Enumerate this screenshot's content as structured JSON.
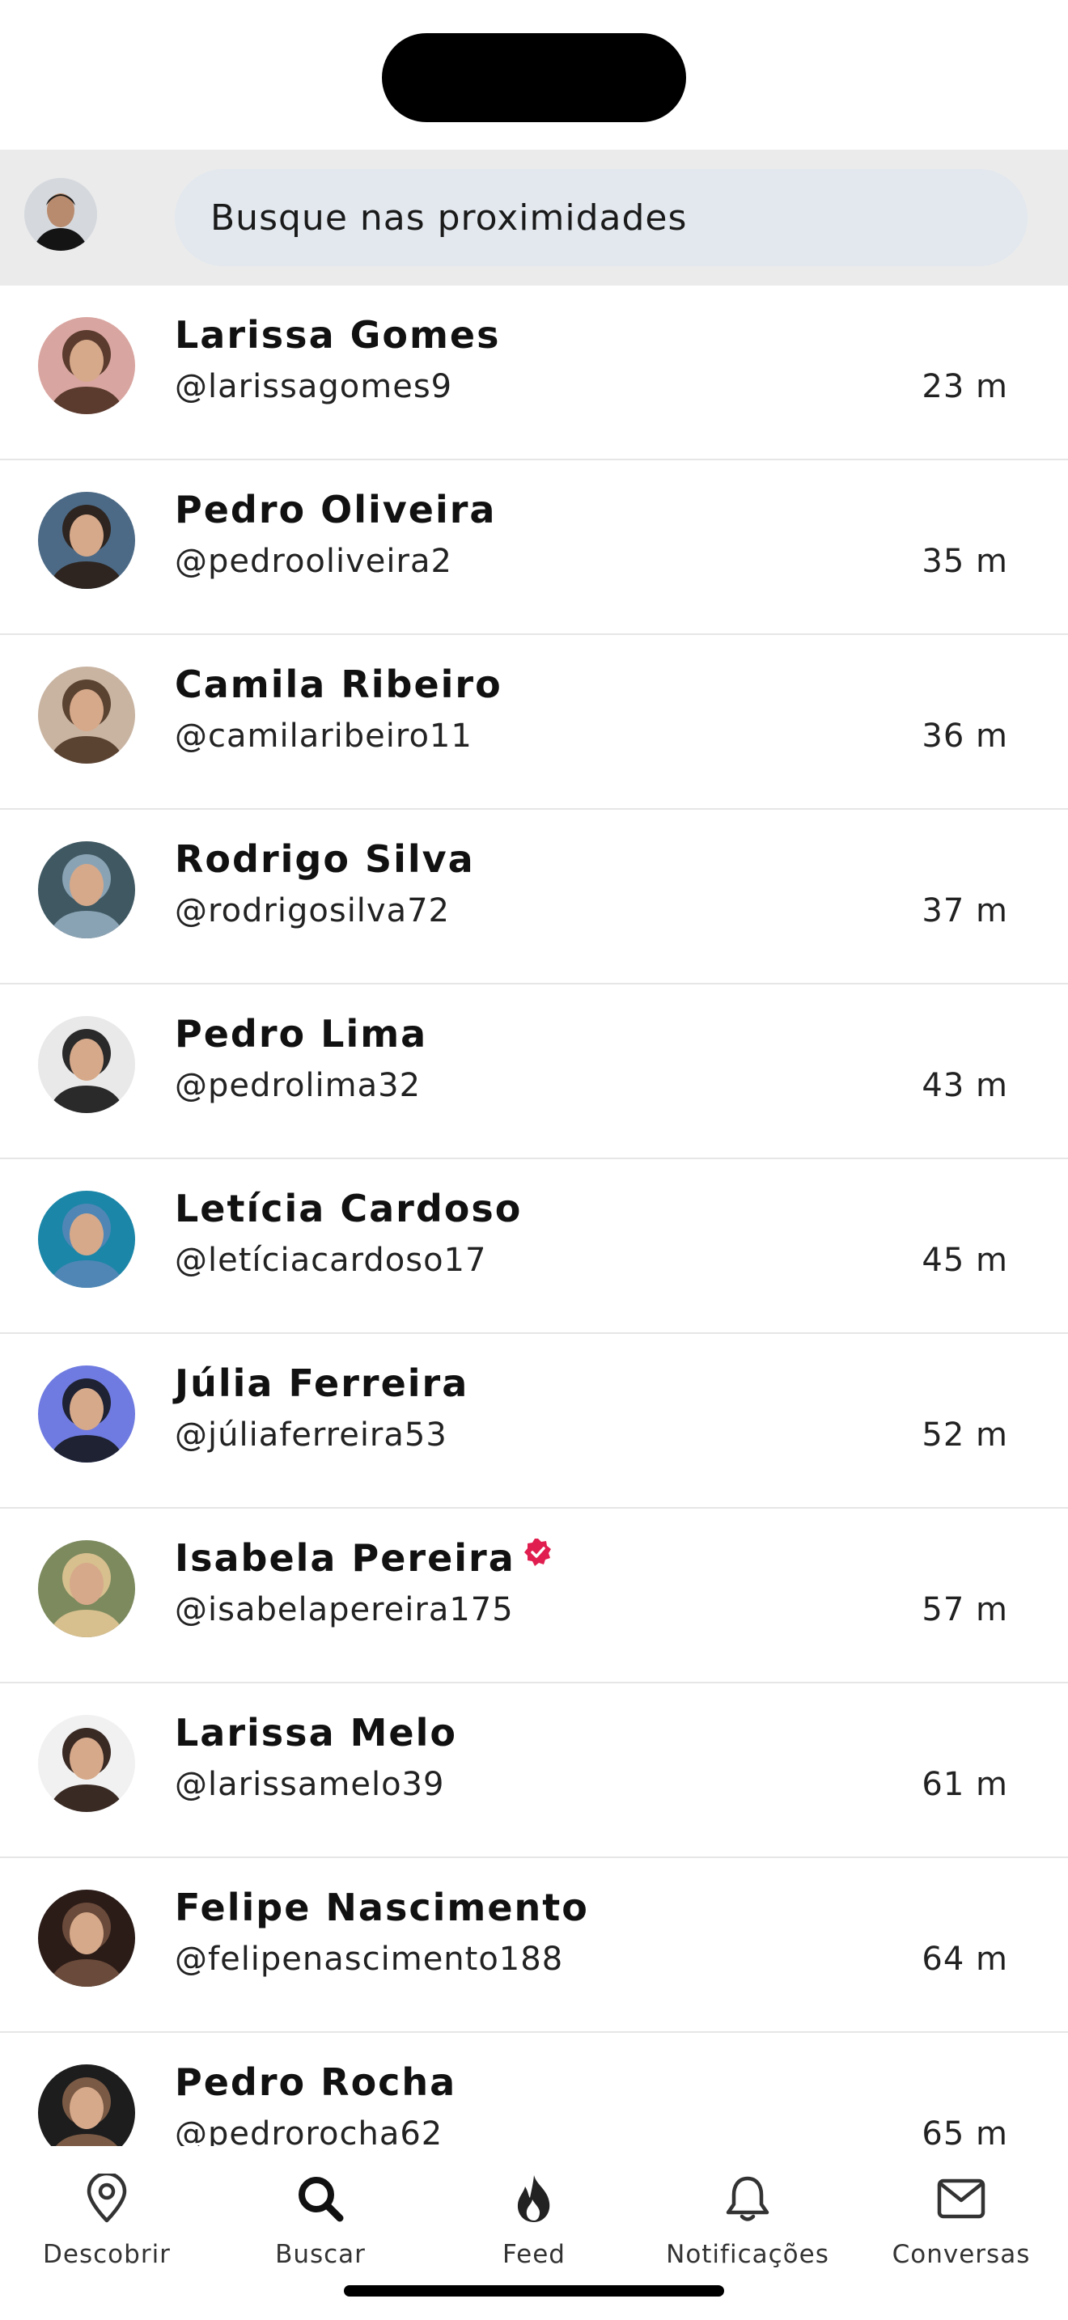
{
  "search": {
    "placeholder": "Busque nas proximidades"
  },
  "people": [
    {
      "name": "Larissa Gomes",
      "handle": "@larissagomes9",
      "distance": "23 m",
      "verified": false,
      "avatar_bg": "#d9a5a0",
      "avatar_fg": "#5a3b2e"
    },
    {
      "name": "Pedro Oliveira",
      "handle": "@pedrooliveira2",
      "distance": "35 m",
      "verified": false,
      "avatar_bg": "#4c6a86",
      "avatar_fg": "#2e2520"
    },
    {
      "name": "Camila Ribeiro",
      "handle": "@camilaribeiro11",
      "distance": "36 m",
      "verified": false,
      "avatar_bg": "#c9b4a2",
      "avatar_fg": "#5b4332"
    },
    {
      "name": "Rodrigo Silva",
      "handle": "@rodrigosilva72",
      "distance": "37 m",
      "verified": false,
      "avatar_bg": "#3f5862",
      "avatar_fg": "#8aa3b4"
    },
    {
      "name": "Pedro Lima",
      "handle": "@pedrolima32",
      "distance": "43 m",
      "verified": false,
      "avatar_bg": "#e9e9e9",
      "avatar_fg": "#2a2a2a"
    },
    {
      "name": "Letícia Cardoso",
      "handle": "@letíciacardoso17",
      "distance": "45 m",
      "verified": false,
      "avatar_bg": "#1c86a8",
      "avatar_fg": "#4f86b5"
    },
    {
      "name": "Júlia Ferreira",
      "handle": "@júliaferreira53",
      "distance": "52 m",
      "verified": false,
      "avatar_bg": "#6f7be0",
      "avatar_fg": "#1e2233"
    },
    {
      "name": "Isabela Pereira",
      "handle": "@isabelapereira175",
      "distance": "57 m",
      "verified": true,
      "avatar_bg": "#7c8a5e",
      "avatar_fg": "#d7bf8e"
    },
    {
      "name": "Larissa Melo",
      "handle": "@larissamelo39",
      "distance": "61 m",
      "verified": false,
      "avatar_bg": "#f1f1f1",
      "avatar_fg": "#3a2a24"
    },
    {
      "name": "Felipe Nascimento",
      "handle": "@felipenascimento188",
      "distance": "64 m",
      "verified": false,
      "avatar_bg": "#2b1c18",
      "avatar_fg": "#6a4a3a"
    },
    {
      "name": "Pedro Rocha",
      "handle": "@pedrorocha62",
      "distance": "65 m",
      "verified": false,
      "avatar_bg": "#1d1d1d",
      "avatar_fg": "#7a5a45"
    }
  ],
  "tabs": [
    {
      "label": "Descobrir",
      "icon": "map-pin-icon"
    },
    {
      "label": "Buscar",
      "icon": "search-icon"
    },
    {
      "label": "Feed",
      "icon": "flame-icon"
    },
    {
      "label": "Notificações",
      "icon": "bell-icon"
    },
    {
      "label": "Conversas",
      "icon": "mail-icon"
    }
  ],
  "colors": {
    "verified_badge": "#e01e4f",
    "search_bg": "#e2e8ee",
    "header_bg": "#ebebeb",
    "active_tab": "#111111",
    "inactive_tab": "#333333"
  }
}
